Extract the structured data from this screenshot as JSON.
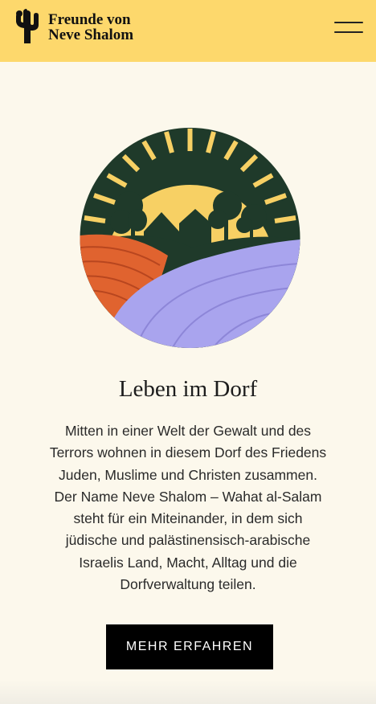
{
  "header": {
    "logo_line1": "Freunde von",
    "logo_line2": "Neve Shalom",
    "logo_icon": "cactus-logo-icon",
    "menu_icon": "hamburger-menu-icon",
    "background_color": "#fdd86c"
  },
  "main": {
    "title": "Leben im Dorf",
    "body_lines": [
      "Mitten in einer Welt der Gewalt und des",
      "Terrors wohnen in diesem Dorf des Friedens",
      "Juden, Muslime und Christen zusammen.",
      "Der Name Neve Shalom – Wahat al-Salam",
      "steht für ein Miteinander, in dem sich",
      "jüdische und palästinensisch-arabische",
      "Israelis Land, Macht, Alltag und die",
      "Dorfverwaltung teilen."
    ],
    "cta_label": "MEHR ERFAHREN"
  },
  "colors": {
    "page_background": "#fcf8ec",
    "illustration_dark": "#1f3a2a",
    "illustration_sun": "#f7d064",
    "illustration_field_orange": "#e0632f",
    "illustration_field_lavender": "#a9a4ee"
  }
}
